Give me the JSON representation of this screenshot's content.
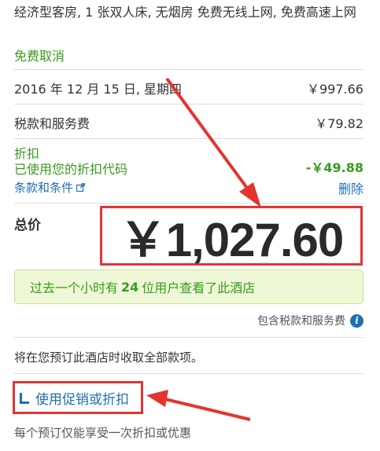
{
  "room": {
    "description": "经济型客房, 1 张双人床, 无烟房 免费无线上网, 免费高速上网",
    "cancellation": "免费取消"
  },
  "nightly": {
    "date": "2016 年 12 月 15 日, 星期四",
    "price": "￥997.66"
  },
  "tax": {
    "label": "税款和服务费",
    "price": "￥79.82"
  },
  "discount": {
    "label": "折扣",
    "sub_label": "已使用您的折扣代码",
    "amount": "-￥49.88",
    "terms_label": "条款和条件",
    "delete_label": "删除"
  },
  "total": {
    "label": "总价",
    "amount": "￥1,027.60"
  },
  "viewed_banner": {
    "prefix": "过去一个小时有",
    "count": "24",
    "suffix": "位用户查看了此酒店"
  },
  "tax_note": {
    "label": "包含税款和服务费",
    "info_icon": "i"
  },
  "payment_note": "将在您预订此酒店时收取全部款项。",
  "promo": {
    "label": "使用促销或折扣",
    "icon": "corner-down-icon"
  },
  "once_note": "每个预订仅能享受一次折扣或优惠",
  "colors": {
    "green": "#3a9a1e",
    "link": "#1f6fb2",
    "highlight": "#e3342f",
    "banner_bg": "#eff8d6"
  }
}
